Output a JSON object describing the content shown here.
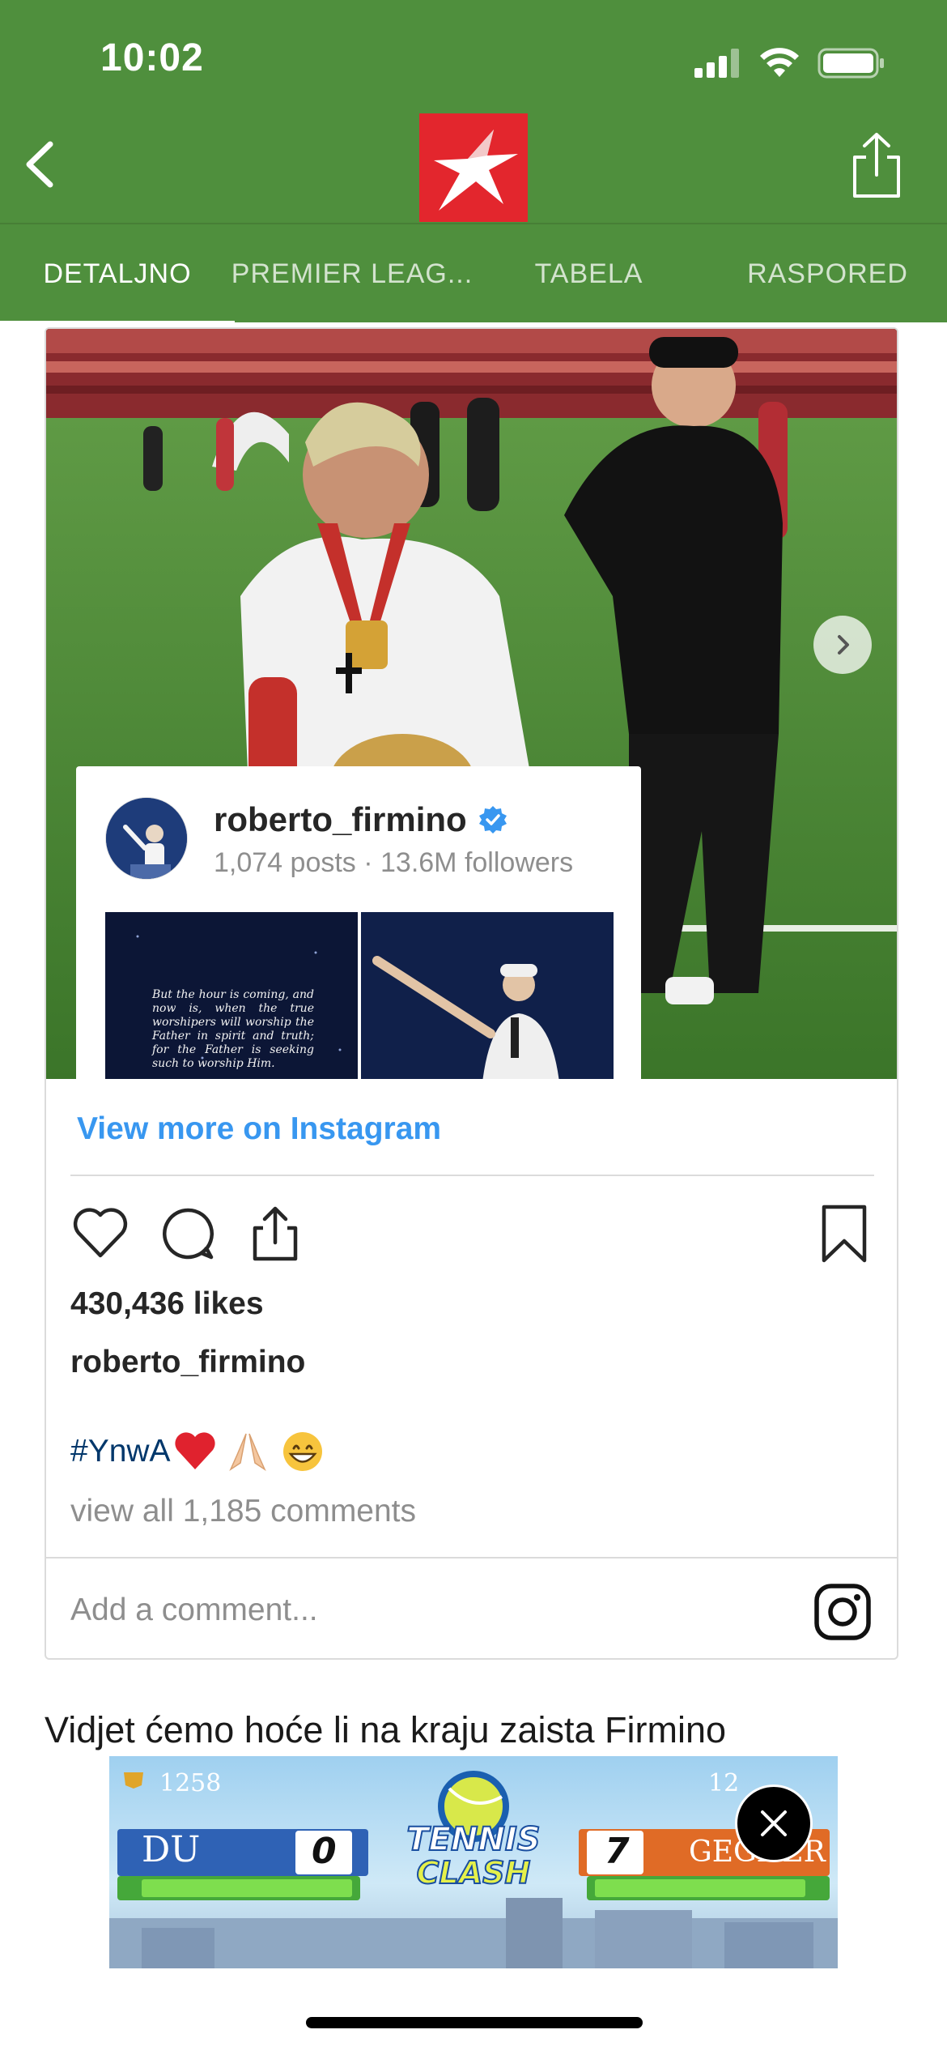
{
  "status_bar": {
    "time": "10:02"
  },
  "nav": {
    "tabs": [
      {
        "label": "DETALJNO",
        "active": true
      },
      {
        "label": "PREMIER LEAG...",
        "active": false
      },
      {
        "label": "TABELA",
        "active": false
      },
      {
        "label": "RASPORED",
        "active": false
      }
    ]
  },
  "colors": {
    "header_green": "#4f8f3d",
    "logo_red": "#e3262d",
    "instagram_link": "#3897f0",
    "hashtag": "#00376b"
  },
  "instagram": {
    "profile": {
      "username": "roberto_firmino",
      "verified": true,
      "stats": "1,074 posts · 13.6M followers",
      "quote": "But the hour is coming, and now is, when the true worshipers will worship the Father in spirit and truth; for the Father is seeking such to worship Him."
    },
    "view_more": "View more on Instagram",
    "likes": "430,436 likes",
    "owner": "roberto_firmino",
    "caption": {
      "hashtag": "#YnwA",
      "emojis": [
        "heart",
        "praying-hands",
        "grinning-face"
      ]
    },
    "view_comments": "view all 1,185 comments",
    "add_comment_placeholder": "Add a comment...",
    "icons": [
      "heart-icon",
      "comment-icon",
      "share-icon",
      "bookmark-icon",
      "instagram-icon"
    ]
  },
  "article": {
    "text": "Vidjet ćemo hoće li na kraju zaista Firmino"
  },
  "ad": {
    "game_title_line1": "TENNIS",
    "game_title_line2": "CLASH",
    "left_score_points": "1258",
    "left_player": "DU",
    "left_set_score": "0",
    "right_score_points": "12",
    "right_player": "GEGNER",
    "right_set_score": "7"
  }
}
